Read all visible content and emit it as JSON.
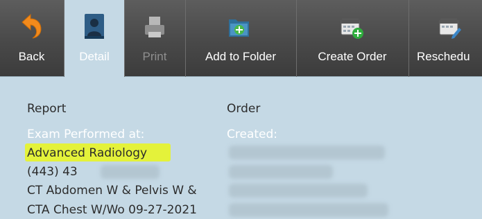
{
  "toolbar": {
    "back_label": "Back",
    "detail_label": "Detail",
    "print_label": "Print",
    "add_to_folder_label": "Add to Folder",
    "create_order_label": "Create Order",
    "reschedule_label": "Reschedu"
  },
  "report": {
    "heading": "Report",
    "exam_performed_label": "Exam Performed at:",
    "facility": "Advanced Radiology",
    "phone": "(443) 43",
    "exam_line1": "CT Abdomen W & Pelvis W &",
    "exam_line2": "CTA Chest W/Wo 09-27-2021"
  },
  "order": {
    "heading": "Order",
    "created_label": "Created:"
  },
  "colors": {
    "toolbar_bg": "#4a4a4a",
    "content_bg": "#c5d9e5",
    "highlight": "#e4f23a"
  }
}
